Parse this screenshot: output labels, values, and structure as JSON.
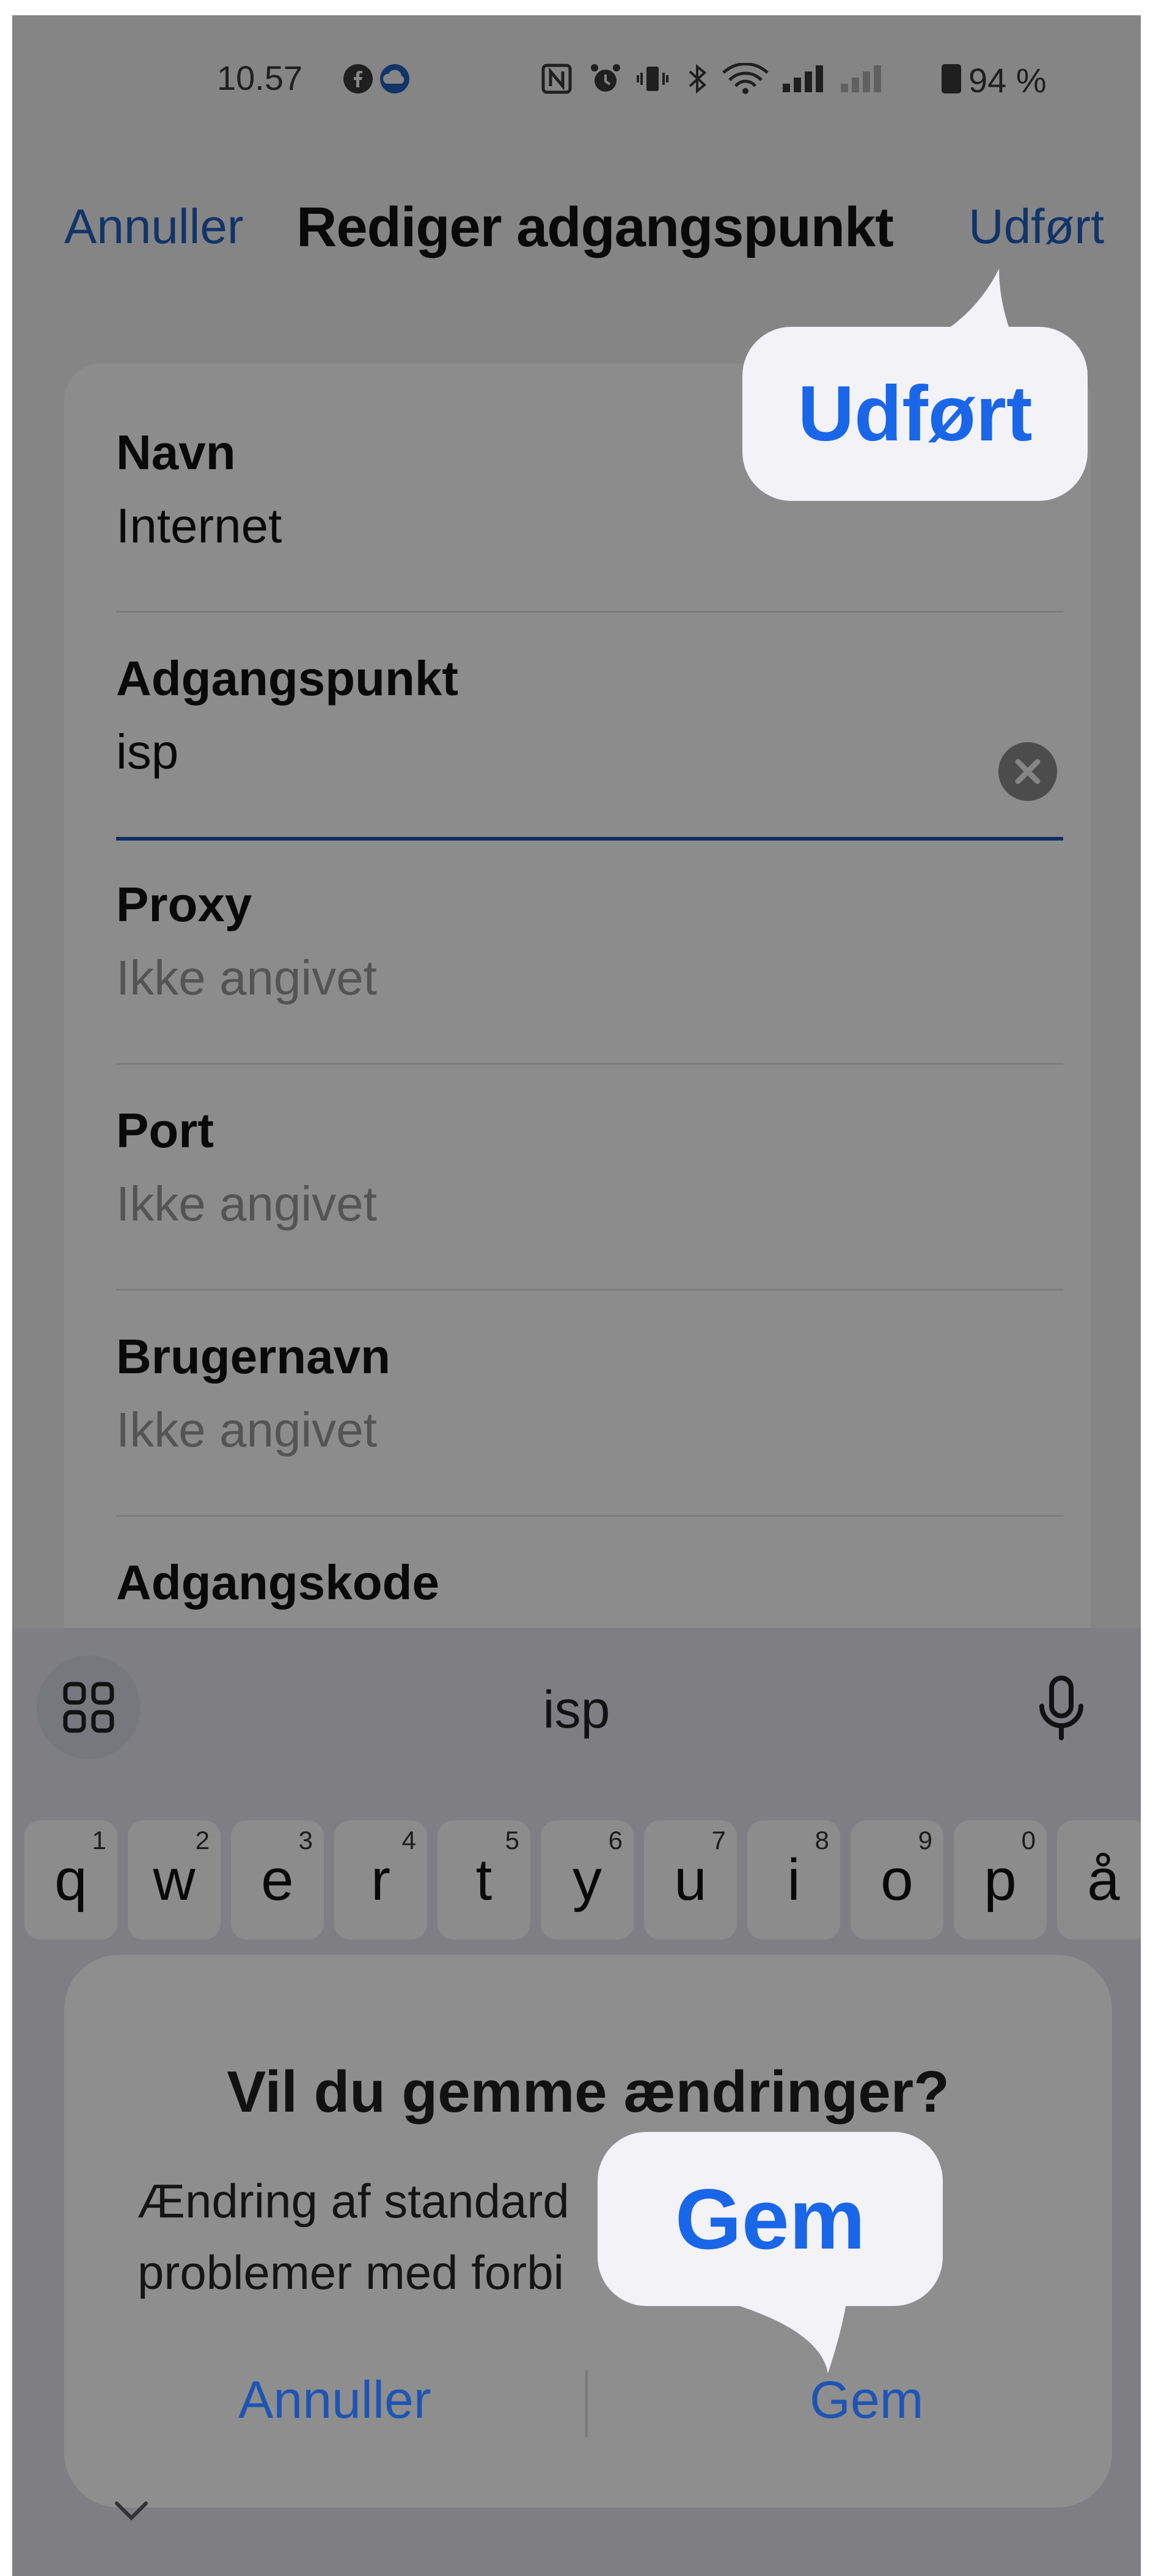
{
  "status_bar": {
    "time": "10.57",
    "battery": "94 %"
  },
  "header": {
    "cancel_label": "Annuller",
    "title": "Rediger adgangspunkt",
    "done_label": "Udført"
  },
  "form": {
    "fields": [
      {
        "label": "Navn",
        "value": "Internet"
      },
      {
        "label": "Adgangspunkt",
        "value": "isp"
      },
      {
        "label": "Proxy",
        "value": "Ikke angivet"
      },
      {
        "label": "Port",
        "value": "Ikke angivet"
      },
      {
        "label": "Brugernavn",
        "value": "Ikke angivet"
      },
      {
        "label": "Adgangskode",
        "value": ""
      }
    ]
  },
  "keyboard": {
    "suggestion": "isp",
    "row1": [
      {
        "key": "q",
        "sup": "1"
      },
      {
        "key": "w",
        "sup": "2"
      },
      {
        "key": "e",
        "sup": "3"
      },
      {
        "key": "r",
        "sup": "4"
      },
      {
        "key": "t",
        "sup": "5"
      },
      {
        "key": "y",
        "sup": "6"
      },
      {
        "key": "u",
        "sup": "7"
      },
      {
        "key": "i",
        "sup": "8"
      },
      {
        "key": "o",
        "sup": "9"
      },
      {
        "key": "p",
        "sup": "0"
      },
      {
        "key": "å",
        "sup": ""
      }
    ]
  },
  "dialog": {
    "title": "Vil du gemme ændringer?",
    "message_line1": "Ændring af standard",
    "message_line2": "problemer med forbi",
    "cancel_label": "Annuller",
    "save_label": "Gem"
  },
  "callouts": {
    "done": "Udført",
    "save": "Gem"
  },
  "colors": {
    "accent": "#1f5fbf",
    "callout_text": "#1a66e8"
  }
}
